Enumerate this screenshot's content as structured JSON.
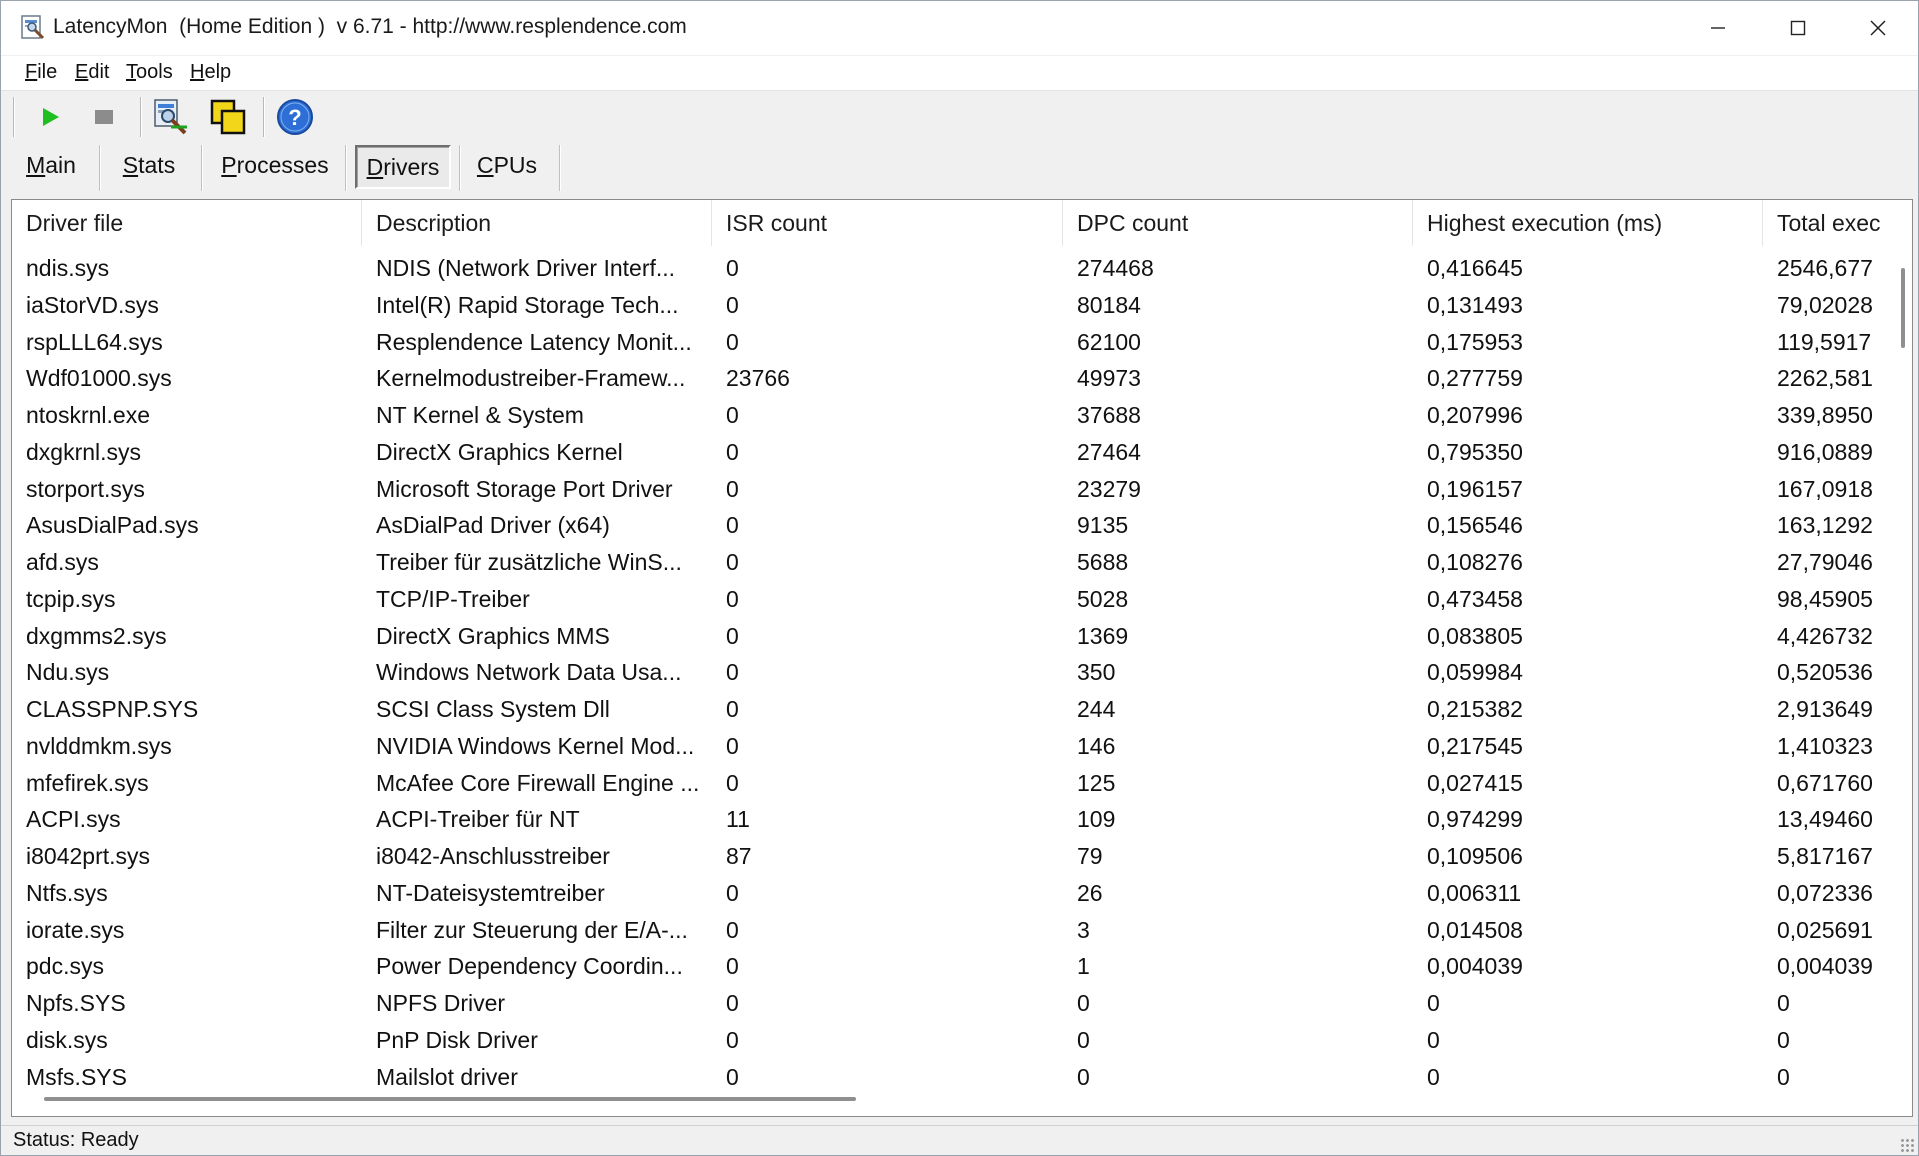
{
  "window": {
    "title": "LatencyMon  (Home Edition )  v 6.71 - http://www.resplendence.com"
  },
  "menu": {
    "items": [
      {
        "label": "File",
        "accel": "F",
        "rest": "ile"
      },
      {
        "label": "Edit",
        "accel": "E",
        "rest": "dit"
      },
      {
        "label": "Tools",
        "accel": "T",
        "rest": "ools"
      },
      {
        "label": "Help",
        "accel": "H",
        "rest": "elp"
      }
    ]
  },
  "toolbar": {
    "icons": [
      "play-icon",
      "stop-icon",
      "analyze-icon",
      "copy-windows-icon",
      "help-icon"
    ],
    "colors": {
      "play": "#1fbf1f",
      "stop": "#8c8c8c",
      "help": "#2d6fd6"
    }
  },
  "tabs": [
    {
      "label": "Main",
      "accel": "M",
      "rest": "ain",
      "active": false
    },
    {
      "label": "Stats",
      "accel": "S",
      "rest": "tats",
      "active": false
    },
    {
      "label": "Processes",
      "accel": "P",
      "rest": "rocesses",
      "active": false
    },
    {
      "label": "Drivers",
      "accel": "D",
      "rest": "rivers",
      "active": true
    },
    {
      "label": "CPUs",
      "accel": "C",
      "rest": "PUs",
      "active": false
    }
  ],
  "table": {
    "columns": [
      "Driver file",
      "Description",
      "ISR count",
      "DPC count",
      "Highest execution (ms)",
      "Total exec"
    ],
    "rows": [
      [
        "ndis.sys",
        "NDIS (Network Driver Interf...",
        "0",
        "274468",
        "0,416645",
        "2546,677"
      ],
      [
        "iaStorVD.sys",
        "Intel(R) Rapid Storage Tech...",
        "0",
        "80184",
        "0,131493",
        "79,02028"
      ],
      [
        "rspLLL64.sys",
        "Resplendence Latency Monit...",
        "0",
        "62100",
        "0,175953",
        "119,5917"
      ],
      [
        "Wdf01000.sys",
        "Kernelmodustreiber-Framew...",
        "23766",
        "49973",
        "0,277759",
        "2262,581"
      ],
      [
        "ntoskrnl.exe",
        "NT Kernel & System",
        "0",
        "37688",
        "0,207996",
        "339,8950"
      ],
      [
        "dxgkrnl.sys",
        "DirectX Graphics Kernel",
        "0",
        "27464",
        "0,795350",
        "916,0889"
      ],
      [
        "storport.sys",
        "Microsoft Storage Port Driver",
        "0",
        "23279",
        "0,196157",
        "167,0918"
      ],
      [
        "AsusDialPad.sys",
        "AsDialPad Driver (x64)",
        "0",
        "9135",
        "0,156546",
        "163,1292"
      ],
      [
        "afd.sys",
        "Treiber für zusätzliche WinS...",
        "0",
        "5688",
        "0,108276",
        "27,79046"
      ],
      [
        "tcpip.sys",
        "TCP/IP-Treiber",
        "0",
        "5028",
        "0,473458",
        "98,45905"
      ],
      [
        "dxgmms2.sys",
        "DirectX Graphics MMS",
        "0",
        "1369",
        "0,083805",
        "4,426732"
      ],
      [
        "Ndu.sys",
        "Windows Network Data Usa...",
        "0",
        "350",
        "0,059984",
        "0,520536"
      ],
      [
        "CLASSPNP.SYS",
        "SCSI Class System Dll",
        "0",
        "244",
        "0,215382",
        "2,913649"
      ],
      [
        "nvlddmkm.sys",
        "NVIDIA Windows Kernel Mod...",
        "0",
        "146",
        "0,217545",
        "1,410323"
      ],
      [
        "mfefirek.sys",
        "McAfee Core Firewall Engine ...",
        "0",
        "125",
        "0,027415",
        "0,671760"
      ],
      [
        "ACPI.sys",
        "ACPI-Treiber für NT",
        "11",
        "109",
        "0,974299",
        "13,49460"
      ],
      [
        "i8042prt.sys",
        "i8042-Anschlusstreiber",
        "87",
        "79",
        "0,109506",
        "5,817167"
      ],
      [
        "Ntfs.sys",
        "NT-Dateisystemtreiber",
        "0",
        "26",
        "0,006311",
        "0,072336"
      ],
      [
        "iorate.sys",
        "Filter zur Steuerung der E/A-...",
        "0",
        "3",
        "0,014508",
        "0,025691"
      ],
      [
        "pdc.sys",
        "Power Dependency Coordin...",
        "0",
        "1",
        "0,004039",
        "0,004039"
      ],
      [
        "Npfs.SYS",
        "NPFS Driver",
        "0",
        "0",
        "0",
        "0"
      ],
      [
        "disk.sys",
        "PnP Disk Driver",
        "0",
        "0",
        "0",
        "0"
      ],
      [
        "Msfs.SYS",
        "Mailslot driver",
        "0",
        "0",
        "0",
        "0"
      ]
    ]
  },
  "status": {
    "text": "Status: Ready"
  }
}
